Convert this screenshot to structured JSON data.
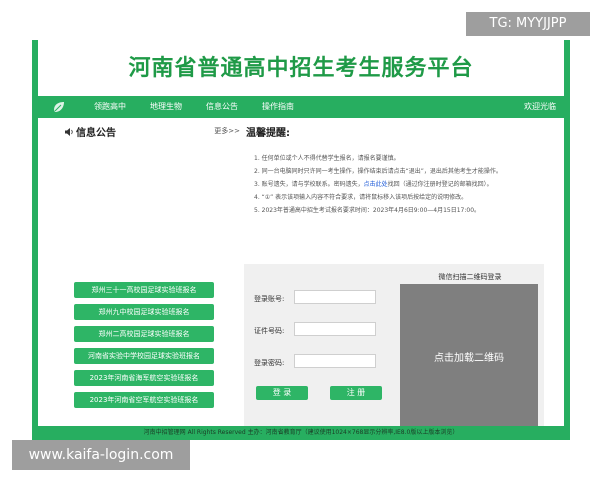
{
  "header": {
    "title": "河南省普通高中招生考生服务平台"
  },
  "nav": {
    "items": [
      "领跑高中",
      "地理生物",
      "信息公告",
      "操作指南"
    ],
    "welcome": "欢迎光临"
  },
  "sidebar": {
    "title": "信息公告",
    "more": "更多>>",
    "buttons": [
      "郑州三十一高校园足球实验班报名",
      "郑州九中校园足球实验班报名",
      "郑州二高校园足球实验班报名",
      "河南省实验中学校园足球实验班报名",
      "2023年河南省海军航空实验班报名",
      "2023年河南省空军航空实验班报名"
    ]
  },
  "tips": {
    "title": "温馨提醒:",
    "items": [
      "1. 任何单位或个人不得代替学生报名，请报名要谨慎。",
      "2. 同一台电脑同时只许同一考生操作，操作结束后请点击“退出”，退出后其他考生才能操作。",
      "3. 账号遗失，请与学校联系。密码遗失，",
      "点击此处",
      "找回（通过你注册时登记的邮箱找回）。",
      "4. “①” 表示该项输入内容不符合要求，请将鼠标移入该项后按给定的说明修改。",
      "5. 2023年普通高中招生考试报名要求时间：2023年4月6日9:00—4月15日17:00。"
    ]
  },
  "login": {
    "account_label": "登录账号:",
    "id_label": "证件号码:",
    "password_label": "登录密码:",
    "account_value": "",
    "id_value": "",
    "password_value": "",
    "login_button": "登 录",
    "register_button": "注 册"
  },
  "qr": {
    "title": "微信扫描二维码登录",
    "placeholder": "点击加载二维码"
  },
  "footer": {
    "text": "河南中招管理网 All Rights Reserved 主办：河南省教育厅（建议使用1024×768显示分辨率,IE8.0版以上版本浏览）"
  },
  "watermarks": {
    "top": "TG: MYYJJPP",
    "bottom": "www.kaifa-login.com"
  },
  "colors": {
    "brand_green": "#27ae60",
    "button_green": "#2eb566",
    "title_green": "#1f9a47",
    "qr_gray": "#7f7f7f"
  }
}
